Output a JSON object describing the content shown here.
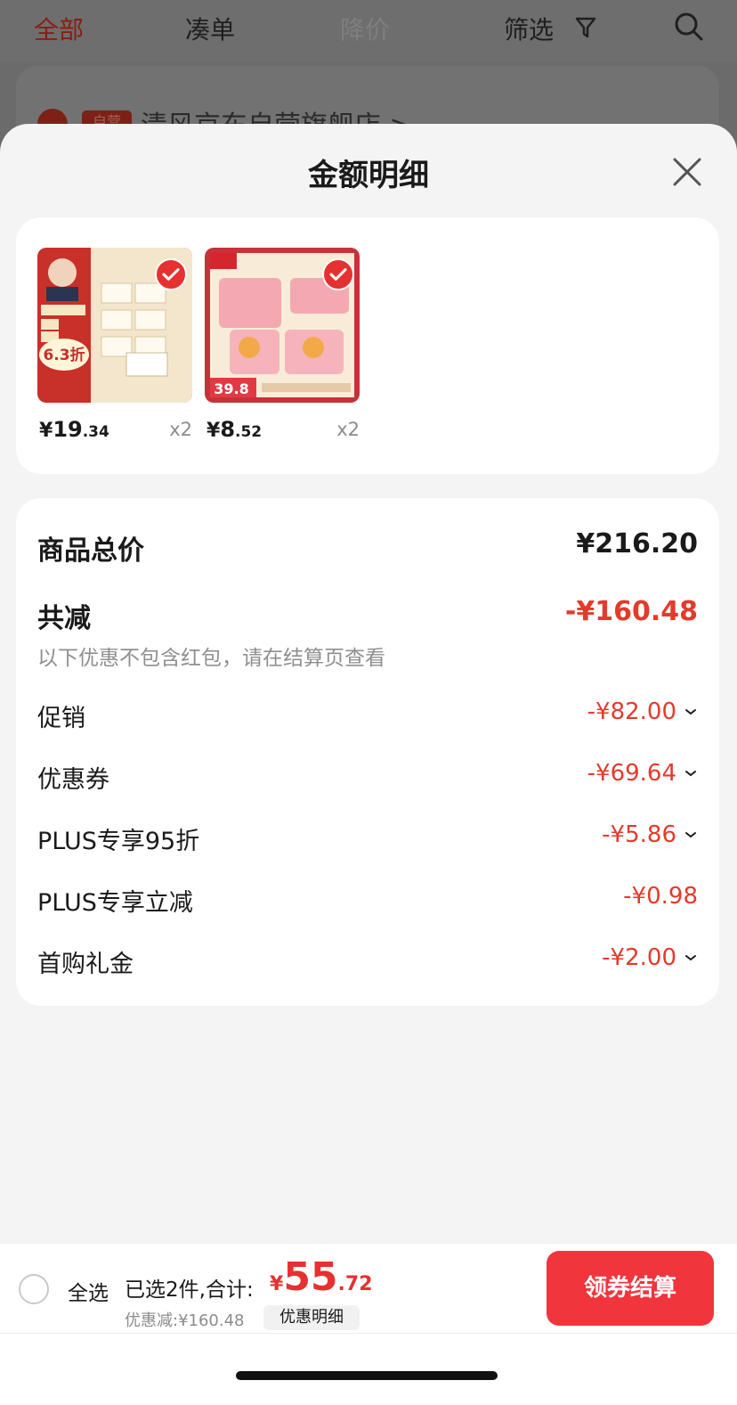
{
  "background": {
    "tabs": [
      "全部",
      "凑单",
      "降价",
      "筛选"
    ],
    "store_badge": "自营",
    "store_name": "清风京东自营旗舰店 >"
  },
  "sheet": {
    "title": "金额明细"
  },
  "products": [
    {
      "price_int": "19",
      "price_dec": ".34",
      "qty": "x2",
      "thumb_text": "6.3折"
    },
    {
      "price_int": "8",
      "price_dec": ".52",
      "qty": "x2",
      "thumb_text": "39.8"
    }
  ],
  "currency": "¥",
  "details": {
    "total_label": "商品总价",
    "total_value": "¥216.20",
    "reduce_label": "共减",
    "reduce_value": "-¥160.48",
    "note": "以下优惠不包含红包，请在结算页查看",
    "items": [
      {
        "label": "促销",
        "value": "-¥82.00"
      },
      {
        "label": "优惠券",
        "value": "-¥69.64"
      },
      {
        "label": "PLUS专享95折",
        "value": "-¥5.86"
      },
      {
        "label": "PLUS专享立减",
        "value": "-¥0.98"
      },
      {
        "label": "首购礼金",
        "value": "-¥2.00"
      }
    ]
  },
  "bottom": {
    "select_all": "全选",
    "selected_text": "已选2件,合计:",
    "total_int": "55",
    "total_dec": ".72",
    "discount_text": "优惠减:¥160.48",
    "detail_chip": "优惠明细",
    "checkout": "领券结算"
  },
  "colors": {
    "accent": "#e5312f",
    "checkout": "#f0353d"
  }
}
